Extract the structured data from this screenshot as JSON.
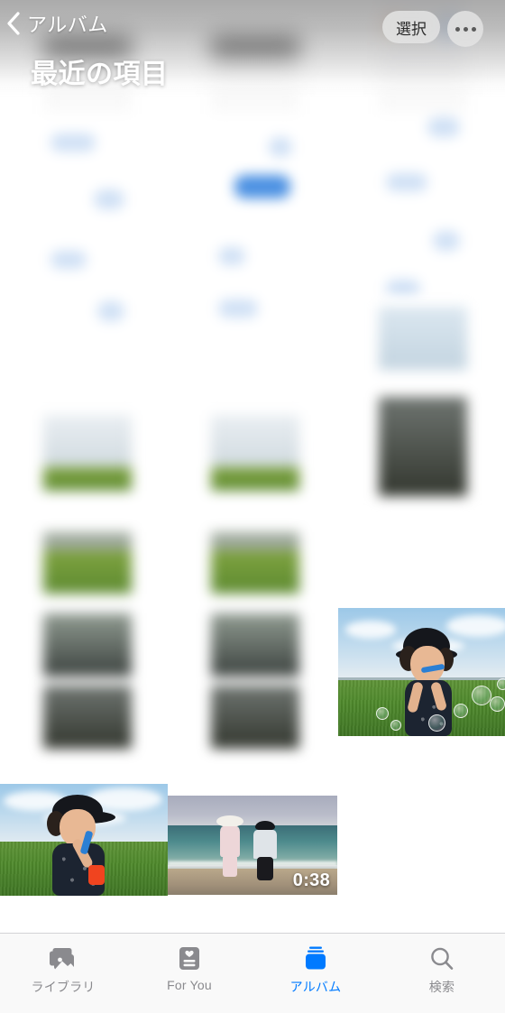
{
  "app": {
    "name": "Photos",
    "accent_color": "#007AFF",
    "inactive_color": "#8a8a8e"
  },
  "navbar": {
    "back_icon": "chevron-left-icon",
    "back_label": "アルバム",
    "title": "最近の項目",
    "select_label": "選択",
    "more_icon": "ellipsis-icon"
  },
  "grid": {
    "columns": 3,
    "items": [
      {
        "id": "i1",
        "type": "screenshot",
        "kind": "calendar",
        "col": 1,
        "duration": null
      },
      {
        "id": "i2",
        "type": "screenshot",
        "kind": "calendar",
        "col": 2,
        "duration": null
      },
      {
        "id": "i3",
        "type": "screenshot",
        "kind": "browser",
        "col": 3,
        "duration": null
      },
      {
        "id": "i4",
        "type": "screenshot",
        "kind": "chat",
        "col": 1,
        "duration": null
      },
      {
        "id": "i5",
        "type": "screenshot",
        "kind": "chat",
        "col": 2,
        "duration": null
      },
      {
        "id": "i6",
        "type": "screenshot",
        "kind": "chat",
        "col": 3,
        "duration": null
      },
      {
        "id": "i7",
        "type": "photo",
        "kind": "landscape",
        "col": 1,
        "duration": null
      },
      {
        "id": "i8",
        "type": "photo",
        "kind": "landscape",
        "col": 2,
        "duration": null
      },
      {
        "id": "i9",
        "type": "photo",
        "kind": "landscape",
        "col": 3,
        "duration": null
      },
      {
        "id": "i10",
        "type": "photo",
        "kind": "bubbles",
        "col": 3,
        "duration": null
      },
      {
        "id": "i11",
        "type": "photo",
        "kind": "boy-field",
        "col": 1,
        "duration": null
      },
      {
        "id": "i12",
        "type": "video",
        "kind": "beach",
        "col": 2,
        "duration": "0:38"
      }
    ]
  },
  "tabbar": {
    "active_index": 2,
    "tabs": [
      {
        "label": "ライブラリ",
        "icon": "photo-stack-icon"
      },
      {
        "label": "For You",
        "icon": "heart-card-icon"
      },
      {
        "label": "アルバム",
        "icon": "albums-stack-icon"
      },
      {
        "label": "検索",
        "icon": "search-icon"
      }
    ]
  }
}
